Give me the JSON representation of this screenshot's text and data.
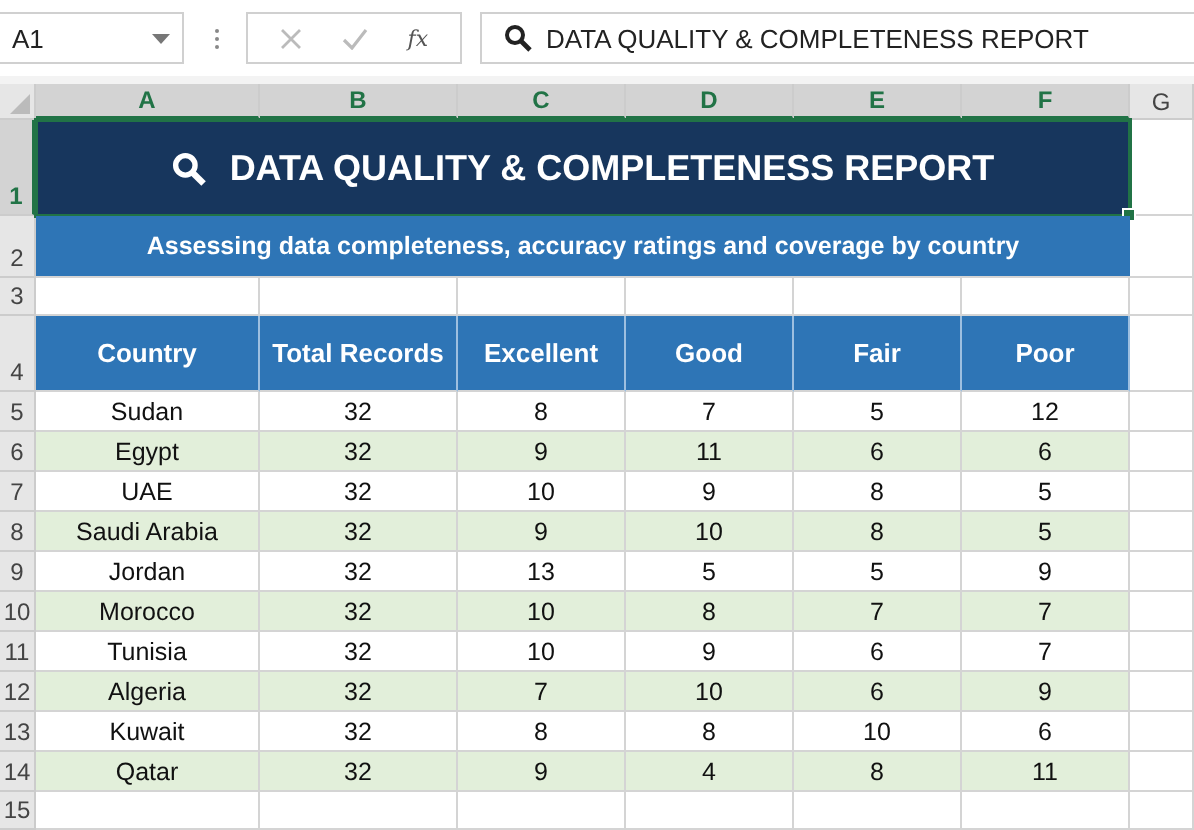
{
  "name_box": {
    "value": "A1"
  },
  "formula_bar": {
    "function_label": "fx",
    "value": "DATA QUALITY & COMPLETENESS REPORT"
  },
  "column_headers": [
    {
      "label": "A",
      "selected": true
    },
    {
      "label": "B",
      "selected": true
    },
    {
      "label": "C",
      "selected": true
    },
    {
      "label": "D",
      "selected": true
    },
    {
      "label": "E",
      "selected": true
    },
    {
      "label": "F",
      "selected": true
    },
    {
      "label": "G",
      "selected": false
    }
  ],
  "title": {
    "row": "1",
    "selected": true,
    "text": "DATA QUALITY & COMPLETENESS REPORT"
  },
  "subtitle": {
    "row": "2",
    "selected": false,
    "text": "Assessing data completeness, accuracy ratings and coverage by country"
  },
  "blank_rows": [
    {
      "row": "3",
      "selected": false
    }
  ],
  "table": {
    "row": "4",
    "selected": false,
    "columns": [
      "Country",
      "Total Records",
      "Excellent",
      "Good",
      "Fair",
      "Poor"
    ],
    "rows": [
      {
        "row": "5",
        "selected": false,
        "shaded": false,
        "cells": [
          "Sudan",
          "32",
          "8",
          "7",
          "5",
          "12"
        ]
      },
      {
        "row": "6",
        "selected": false,
        "shaded": true,
        "cells": [
          "Egypt",
          "32",
          "9",
          "11",
          "6",
          "6"
        ]
      },
      {
        "row": "7",
        "selected": false,
        "shaded": false,
        "cells": [
          "UAE",
          "32",
          "10",
          "9",
          "8",
          "5"
        ]
      },
      {
        "row": "8",
        "selected": false,
        "shaded": true,
        "cells": [
          "Saudi Arabia",
          "32",
          "9",
          "10",
          "8",
          "5"
        ]
      },
      {
        "row": "9",
        "selected": false,
        "shaded": false,
        "cells": [
          "Jordan",
          "32",
          "13",
          "5",
          "5",
          "9"
        ]
      },
      {
        "row": "10",
        "selected": false,
        "shaded": true,
        "cells": [
          "Morocco",
          "32",
          "10",
          "8",
          "7",
          "7"
        ]
      },
      {
        "row": "11",
        "selected": false,
        "shaded": false,
        "cells": [
          "Tunisia",
          "32",
          "10",
          "9",
          "6",
          "7"
        ]
      },
      {
        "row": "12",
        "selected": false,
        "shaded": true,
        "cells": [
          "Algeria",
          "32",
          "7",
          "10",
          "6",
          "9"
        ]
      },
      {
        "row": "13",
        "selected": false,
        "shaded": false,
        "cells": [
          "Kuwait",
          "32",
          "8",
          "8",
          "10",
          "6"
        ]
      },
      {
        "row": "14",
        "selected": false,
        "shaded": true,
        "cells": [
          "Qatar",
          "32",
          "9",
          "4",
          "8",
          "11"
        ]
      }
    ]
  },
  "trailing_rows": [
    {
      "row": "15",
      "selected": false
    }
  ]
}
